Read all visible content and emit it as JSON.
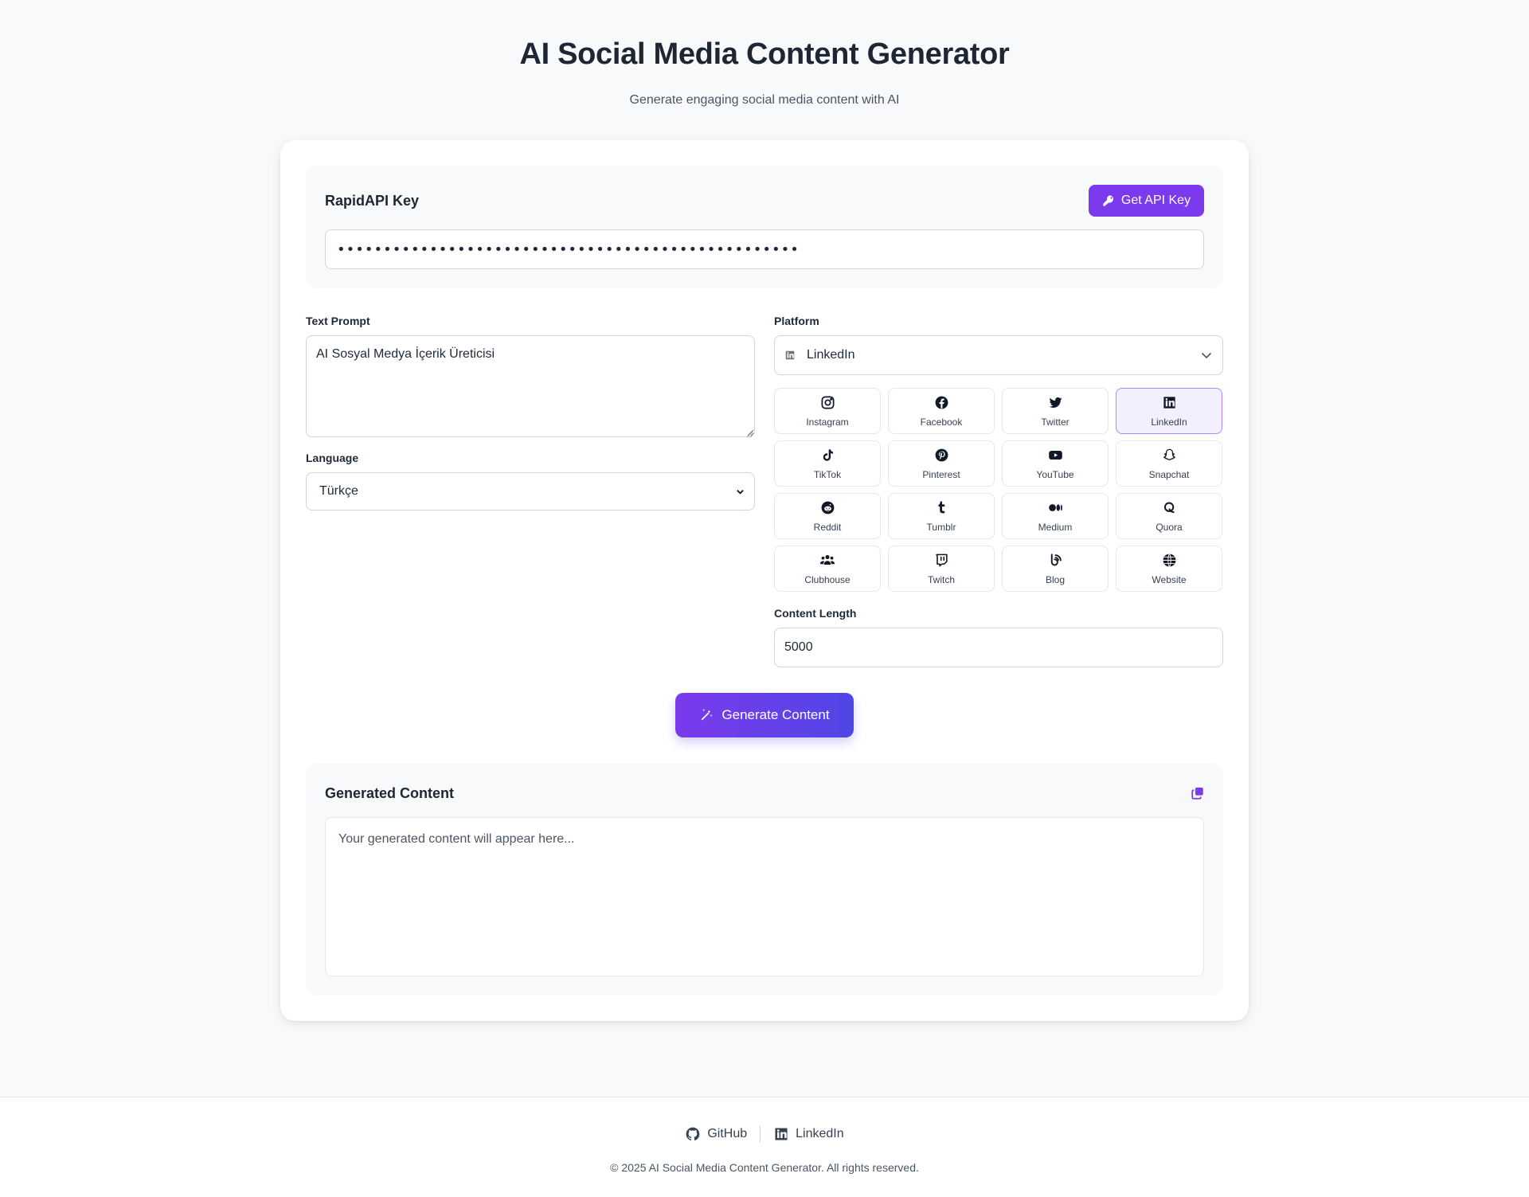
{
  "header": {
    "title": "AI Social Media Content Generator",
    "subtitle": "Generate engaging social media content with AI"
  },
  "api": {
    "title": "RapidAPI Key",
    "get_key_label": "Get API Key",
    "key_value": "••••••••••••••••••••••••••••••••••••••••••••••••••"
  },
  "prompt": {
    "label": "Text Prompt",
    "value": "AI Sosyal Medya İçerik Üreticisi"
  },
  "language": {
    "label": "Language",
    "selected": "Türkçe"
  },
  "platform": {
    "label": "Platform",
    "selected": "LinkedIn",
    "options": [
      {
        "label": "Instagram",
        "icon": "instagram-icon"
      },
      {
        "label": "Facebook",
        "icon": "facebook-icon"
      },
      {
        "label": "Twitter",
        "icon": "twitter-icon"
      },
      {
        "label": "LinkedIn",
        "icon": "linkedin-icon",
        "active": true
      },
      {
        "label": "TikTok",
        "icon": "tiktok-icon"
      },
      {
        "label": "Pinterest",
        "icon": "pinterest-icon"
      },
      {
        "label": "YouTube",
        "icon": "youtube-icon"
      },
      {
        "label": "Snapchat",
        "icon": "snapchat-icon"
      },
      {
        "label": "Reddit",
        "icon": "reddit-icon"
      },
      {
        "label": "Tumblr",
        "icon": "tumblr-icon"
      },
      {
        "label": "Medium",
        "icon": "medium-icon"
      },
      {
        "label": "Quora",
        "icon": "quora-icon"
      },
      {
        "label": "Clubhouse",
        "icon": "users-icon"
      },
      {
        "label": "Twitch",
        "icon": "twitch-icon"
      },
      {
        "label": "Blog",
        "icon": "blog-icon"
      },
      {
        "label": "Website",
        "icon": "globe-icon"
      }
    ]
  },
  "length": {
    "label": "Content Length",
    "value": "5000"
  },
  "generate": {
    "label": "Generate Content"
  },
  "output": {
    "title": "Generated Content",
    "placeholder": "Your generated content will appear here..."
  },
  "footer": {
    "github_label": "GitHub",
    "linkedin_label": "LinkedIn",
    "copyright": "© 2025 AI Social Media Content Generator. All rights reserved."
  },
  "colors": {
    "accent": "#7c3aed",
    "accent_gradient_end": "#4f46e5",
    "background": "#f8f9fb",
    "text": "#1e2533"
  }
}
